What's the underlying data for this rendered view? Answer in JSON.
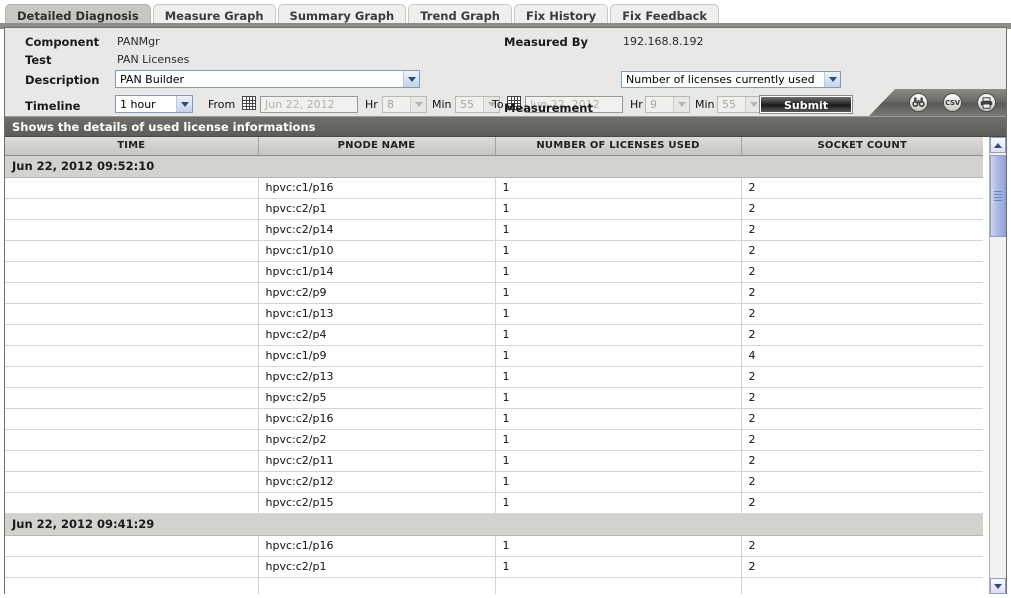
{
  "tabs": [
    {
      "label": "Detailed Diagnosis",
      "active": true
    },
    {
      "label": "Measure Graph",
      "active": false
    },
    {
      "label": "Summary Graph",
      "active": false
    },
    {
      "label": "Trend Graph",
      "active": false
    },
    {
      "label": "Fix History",
      "active": false
    },
    {
      "label": "Fix Feedback",
      "active": false
    }
  ],
  "form": {
    "component_label": "Component",
    "component_value": "PANMgr",
    "test_label": "Test",
    "test_value": "PAN Licenses",
    "description_label": "Description",
    "description_value": "PAN Builder",
    "timeline_label": "Timeline",
    "timeline_value": "1 hour",
    "measured_by_label": "Measured By",
    "measured_by_value": "192.168.8.192",
    "measurement_label": "Measurement",
    "measurement_value": "Number of licenses currently used",
    "from_label": "From",
    "from_date": "Jun 22, 2012",
    "from_hr_label": "Hr",
    "from_hr_value": "8",
    "from_min_label": "Min",
    "from_min_value": "55",
    "to_label": "To",
    "to_date": "Jun 22, 2012",
    "to_hr_label": "Hr",
    "to_hr_value": "9",
    "to_min_label": "Min",
    "to_min_value": "55",
    "submit_label": "Submit"
  },
  "toolbar_icons": [
    {
      "name": "binoculars-icon",
      "label": ""
    },
    {
      "name": "csv-icon",
      "label": "CSV"
    },
    {
      "name": "printer-icon",
      "label": ""
    }
  ],
  "subheader": {
    "title": "Shows the details of used license informations"
  },
  "table": {
    "columns": [
      "TIME",
      "PNODE NAME",
      "NUMBER OF LICENSES USED",
      "SOCKET COUNT"
    ],
    "groups": [
      {
        "time": "Jun 22, 2012 09:52:10",
        "rows": [
          {
            "pnode": "hpvc:c1/p16",
            "licenses": "1",
            "sockets": "2"
          },
          {
            "pnode": "hpvc:c2/p1",
            "licenses": "1",
            "sockets": "2"
          },
          {
            "pnode": "hpvc:c2/p14",
            "licenses": "1",
            "sockets": "2"
          },
          {
            "pnode": "hpvc:c1/p10",
            "licenses": "1",
            "sockets": "2"
          },
          {
            "pnode": "hpvc:c1/p14",
            "licenses": "1",
            "sockets": "2"
          },
          {
            "pnode": "hpvc:c2/p9",
            "licenses": "1",
            "sockets": "2"
          },
          {
            "pnode": "hpvc:c1/p13",
            "licenses": "1",
            "sockets": "2"
          },
          {
            "pnode": "hpvc:c2/p4",
            "licenses": "1",
            "sockets": "2"
          },
          {
            "pnode": "hpvc:c1/p9",
            "licenses": "1",
            "sockets": "4"
          },
          {
            "pnode": "hpvc:c2/p13",
            "licenses": "1",
            "sockets": "2"
          },
          {
            "pnode": "hpvc:c2/p5",
            "licenses": "1",
            "sockets": "2"
          },
          {
            "pnode": "hpvc:c2/p16",
            "licenses": "1",
            "sockets": "2"
          },
          {
            "pnode": "hpvc:c2/p2",
            "licenses": "1",
            "sockets": "2"
          },
          {
            "pnode": "hpvc:c2/p11",
            "licenses": "1",
            "sockets": "2"
          },
          {
            "pnode": "hpvc:c2/p12",
            "licenses": "1",
            "sockets": "2"
          },
          {
            "pnode": "hpvc:c2/p15",
            "licenses": "1",
            "sockets": "2"
          }
        ]
      },
      {
        "time": "Jun 22, 2012 09:41:29",
        "rows": [
          {
            "pnode": "hpvc:c1/p16",
            "licenses": "1",
            "sockets": "2"
          },
          {
            "pnode": "hpvc:c2/p1",
            "licenses": "1",
            "sockets": "2"
          }
        ]
      }
    ]
  },
  "colors": {
    "accent_select_border": "#7f9db9",
    "subheader_bg": "#5e5c59",
    "group_row_bg": "#d3d2cf",
    "active_tab_bg": "#c8c7c4",
    "scroll_thumb": "#93a5de"
  }
}
